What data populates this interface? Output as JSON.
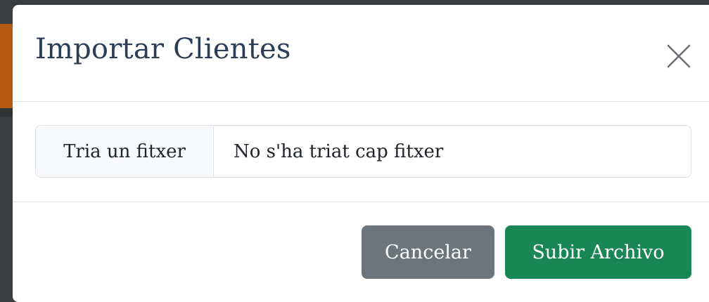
{
  "modal": {
    "title": "Importar Clientes",
    "close_icon": "close-icon"
  },
  "file_input": {
    "button_label": "Tria un fitxer",
    "status_text": "No s'ha triat cap fitxer"
  },
  "footer": {
    "cancel_label": "Cancelar",
    "submit_label": "Subir Archivo"
  },
  "colors": {
    "title": "#2c3e56",
    "cancel_button": "#6c757d",
    "submit_button": "#198754"
  }
}
